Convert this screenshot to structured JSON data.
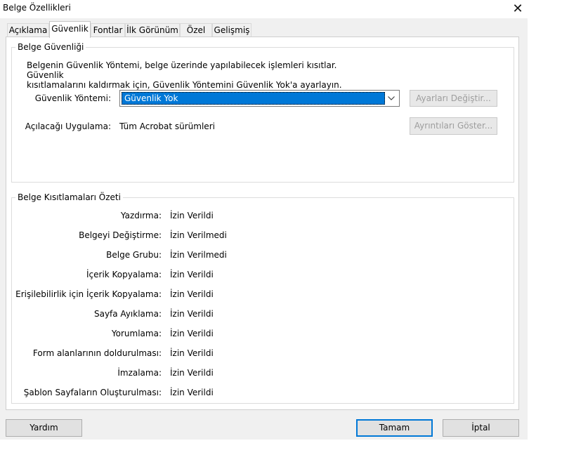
{
  "window": {
    "title": "Belge Özellikleri",
    "close_glyph": "✕"
  },
  "tabs": [
    "Açıklama",
    "Güvenlik",
    "Fontlar",
    "İlk Görünüm",
    "Özel",
    "Gelişmiş"
  ],
  "security_group": {
    "legend": "Belge Güvenliği",
    "info_line1": "Belgenin Güvenlik Yöntemi, belge üzerinde yapılabilecek işlemleri kısıtlar. Güvenlik",
    "info_line2": "kısıtlamalarını kaldırmak için, Güvenlik Yöntemini Güvenlik Yok'a ayarlayın.",
    "method_label": "Güvenlik Yöntemi:",
    "method_value": "Güvenlik Yok",
    "change_settings_button": "Ayarları Değiştir...",
    "app_label": "Açılacağı Uygulama:",
    "app_value": "Tüm Acrobat sürümleri",
    "show_details_button": "Ayrıntıları Göster..."
  },
  "restrictions_group": {
    "legend": "Belge Kısıtlamaları Özeti",
    "rows": [
      {
        "label": "Yazdırma:",
        "value": "İzin Verildi"
      },
      {
        "label": "Belgeyi Değiştirme:",
        "value": "İzin Verilmedi"
      },
      {
        "label": "Belge Grubu:",
        "value": "İzin Verilmedi"
      },
      {
        "label": "İçerik Kopyalama:",
        "value": "İzin Verildi"
      },
      {
        "label": "Erişilebilirlik için İçerik Kopyalama:",
        "value": "İzin Verildi"
      },
      {
        "label": "Sayfa Ayıklama:",
        "value": "İzin Verildi"
      },
      {
        "label": "Yorumlama:",
        "value": "İzin Verildi"
      },
      {
        "label": "Form alanlarının doldurulması:",
        "value": "İzin Verildi"
      },
      {
        "label": "İmzalama:",
        "value": "İzin Verildi"
      },
      {
        "label": "Şablon Sayfaların Oluşturulması:",
        "value": "İzin Verildi"
      }
    ]
  },
  "footer": {
    "help_button": "Yardım",
    "ok_button": "Tamam",
    "cancel_button": "İptal"
  },
  "colors": {
    "accent": "#0078d7",
    "dialog_bg": "#f0f0f0"
  }
}
